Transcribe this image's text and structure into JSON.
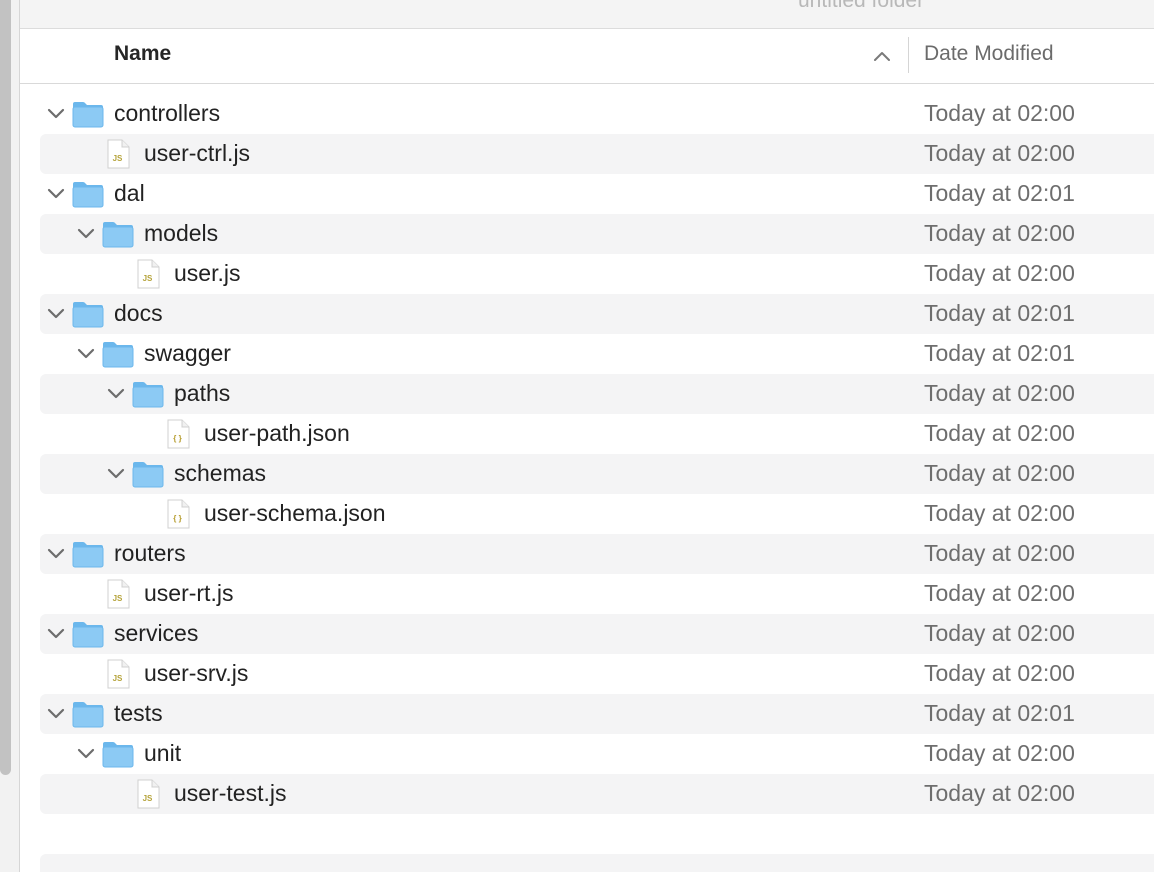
{
  "toolbar": {
    "title": "untitled folder"
  },
  "columns": {
    "name": "Name",
    "date_modified": "Date Modified",
    "sort_icon": "chevron-up-icon"
  },
  "rows": [
    {
      "name": "controllers",
      "date": "Today at 02:00",
      "type": "folder",
      "depth": 0,
      "expanded": true
    },
    {
      "name": "user-ctrl.js",
      "date": "Today at 02:00",
      "type": "js",
      "depth": 1
    },
    {
      "name": "dal",
      "date": "Today at 02:01",
      "type": "folder",
      "depth": 0,
      "expanded": true
    },
    {
      "name": "models",
      "date": "Today at 02:00",
      "type": "folder",
      "depth": 1,
      "expanded": true
    },
    {
      "name": "user.js",
      "date": "Today at 02:00",
      "type": "js",
      "depth": 2
    },
    {
      "name": "docs",
      "date": "Today at 02:01",
      "type": "folder",
      "depth": 0,
      "expanded": true
    },
    {
      "name": "swagger",
      "date": "Today at 02:01",
      "type": "folder",
      "depth": 1,
      "expanded": true
    },
    {
      "name": "paths",
      "date": "Today at 02:00",
      "type": "folder",
      "depth": 2,
      "expanded": true
    },
    {
      "name": "user-path.json",
      "date": "Today at 02:00",
      "type": "json",
      "depth": 3
    },
    {
      "name": "schemas",
      "date": "Today at 02:00",
      "type": "folder",
      "depth": 2,
      "expanded": true
    },
    {
      "name": "user-schema.json",
      "date": "Today at 02:00",
      "type": "json",
      "depth": 3
    },
    {
      "name": "routers",
      "date": "Today at 02:00",
      "type": "folder",
      "depth": 0,
      "expanded": true
    },
    {
      "name": "user-rt.js",
      "date": "Today at 02:00",
      "type": "js",
      "depth": 1
    },
    {
      "name": "services",
      "date": "Today at 02:00",
      "type": "folder",
      "depth": 0,
      "expanded": true
    },
    {
      "name": "user-srv.js",
      "date": "Today at 02:00",
      "type": "js",
      "depth": 1
    },
    {
      "name": "tests",
      "date": "Today at 02:01",
      "type": "folder",
      "depth": 0,
      "expanded": true
    },
    {
      "name": "unit",
      "date": "Today at 02:00",
      "type": "folder",
      "depth": 1,
      "expanded": true
    },
    {
      "name": "user-test.js",
      "date": "Today at 02:00",
      "type": "js",
      "depth": 2
    }
  ],
  "file_badges": {
    "js": "JS",
    "json": "{ }"
  },
  "colors": {
    "folder": "#6bb7ec",
    "folder_tab": "#8ccaf4",
    "row_stripe": "#f4f4f5",
    "js_badge": "#b5a33a",
    "json_badge": "#b59b2a"
  }
}
